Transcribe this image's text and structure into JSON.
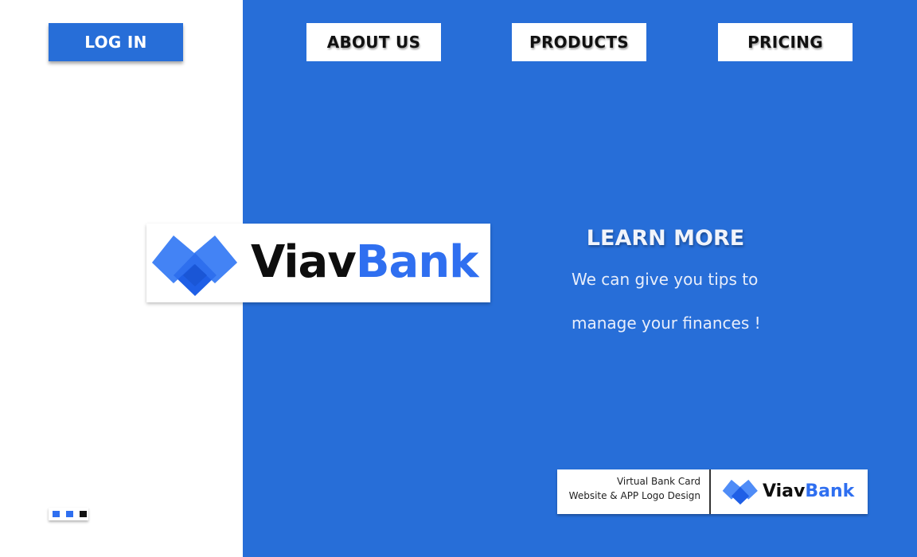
{
  "nav": {
    "login_label": "LOG IN",
    "about_label": "ABOUT US",
    "products_label": "PRODUCTS",
    "pricing_label": "PRICING"
  },
  "brand": {
    "name_dark": "Viav",
    "name_blue": "Bank",
    "logo_icon": "double-diamond-icon",
    "accent_color": "#276ed8",
    "logo_blue": "#2f6ff0"
  },
  "hero": {
    "title": "LEARN MORE",
    "line1": "We can give you tips to",
    "line2": "manage your finances !"
  },
  "mini_card": {
    "line1": "Virtual Bank Card",
    "line2": "Website & APP Logo Design",
    "name_dark": "Viav",
    "name_blue": "Bank"
  },
  "pager": {
    "total": 3,
    "active": 3
  }
}
